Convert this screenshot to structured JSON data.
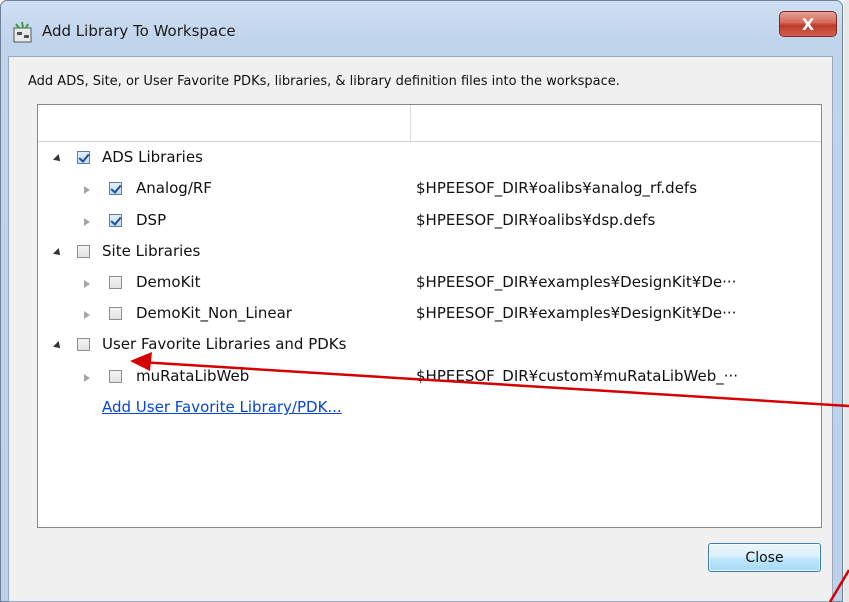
{
  "window": {
    "title": "Add Library To Workspace",
    "close_glyph": "X",
    "app_icon": "ads-app-icon"
  },
  "description": "Add ADS, Site, or User Favorite PDKs, libraries, & library definition files into the workspace.",
  "tree": {
    "groups": [
      {
        "label": "ADS Libraries",
        "expanded": true,
        "checked": true,
        "items": [
          {
            "label": "Analog/RF",
            "checked": true,
            "path": "$HPEESOF_DIR¥oalibs¥analog_rf.defs"
          },
          {
            "label": "DSP",
            "checked": true,
            "path": "$HPEESOF_DIR¥oalibs¥dsp.defs"
          }
        ]
      },
      {
        "label": "Site Libraries",
        "expanded": true,
        "checked": false,
        "items": [
          {
            "label": "DemoKit",
            "checked": false,
            "path": "$HPEESOF_DIR¥examples¥DesignKit¥De···"
          },
          {
            "label": "DemoKit_Non_Linear",
            "checked": false,
            "path": "$HPEESOF_DIR¥examples¥DesignKit¥De···"
          }
        ]
      },
      {
        "label": "User Favorite Libraries and PDKs",
        "expanded": true,
        "checked": false,
        "items": [
          {
            "label": "muRataLibWeb",
            "checked": false,
            "path": "$HPEESOF_DIR¥custom¥muRataLibWeb_···"
          }
        ]
      }
    ],
    "add_link": "Add User Favorite Library/PDK..."
  },
  "buttons": {
    "close": "Close"
  },
  "annotation": {
    "arrow_color": "#d40000"
  },
  "colors": {
    "link": "#0645d6",
    "titlebar": "#c0d4ec",
    "close_button_red": "#c0392b"
  }
}
